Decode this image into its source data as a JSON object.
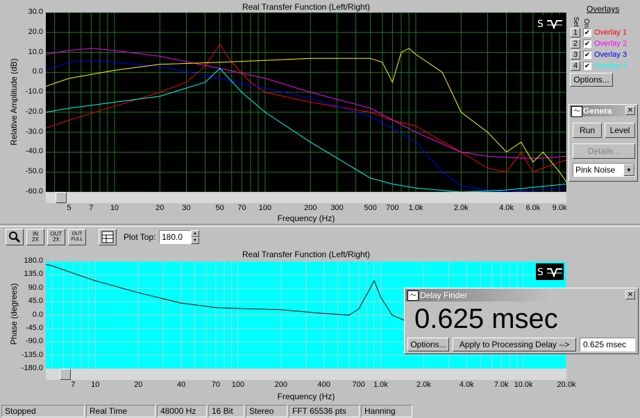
{
  "top_panel": {
    "title": "Real Transfer Function (Left/Right)",
    "ylabel": "Relative Amplitude (dB)",
    "xlabel": "Frequency (Hz)",
    "yticks": [
      "30.0",
      "20.0",
      "10.0",
      "0.0",
      "-10.0",
      "-20.0",
      "-30.0",
      "-40.0",
      "-50.0",
      "-60.0"
    ],
    "xticks": [
      "5",
      "7",
      "10",
      "20",
      "30",
      "50",
      "70",
      "100",
      "200",
      "300",
      "500",
      "700",
      "1.0k",
      "2.0k",
      "4.0k",
      "6.0k",
      "9.0k"
    ]
  },
  "bottom_panel": {
    "title": "Real Transfer Function (Left/Right)",
    "ylabel": "Phase (degrees)",
    "xlabel": "Frequency (Hz)",
    "yticks": [
      "180.0",
      "135.0",
      "90.0",
      "45.0",
      "0.0",
      "-45.0",
      "-90.0",
      "-135.0",
      "-180.0"
    ],
    "xticks": [
      "7",
      "10",
      "20",
      "40",
      "70",
      "100",
      "200",
      "400",
      "700",
      "1.0k",
      "2.0k",
      "4.0k",
      "7.0k",
      "10.0k",
      "20.0k"
    ]
  },
  "toolbar": {
    "plot_top_label": "Plot Top:",
    "plot_top_value": "180.0",
    "zoom_in_label": "IN\n2X",
    "zoom_out_label": "OUT\n2X",
    "zoom_full_label": "OUT\nFULL"
  },
  "overlays": {
    "title": "Overlays",
    "col_set": "Set",
    "col_on": "On",
    "items": [
      {
        "num": "1",
        "label": "Overlay 1",
        "color": "#ff0000"
      },
      {
        "num": "2",
        "label": "Overlay 2",
        "color": "#ff00ff"
      },
      {
        "num": "3",
        "label": "Overlay 3",
        "color": "#0000ff"
      },
      {
        "num": "4",
        "label": "Overlay 4",
        "color": "#00ffff"
      }
    ],
    "options_label": "Options..."
  },
  "generator": {
    "title": "Genera",
    "run_label": "Run",
    "level_label": "Level",
    "details_label": "Details...",
    "noise_value": "Pink Noise"
  },
  "delay_finder": {
    "title": "Delay Finder",
    "value": "0.625 msec",
    "options_label": "Options...",
    "apply_label": "Apply to Processing Delay -->",
    "field_value": "0.625 msec"
  },
  "status": [
    "Stopped",
    "Real Time",
    "48000 Hz",
    "16 Bit",
    "Stereo",
    "FFT 65536 pts",
    "Hanning"
  ],
  "chart_data": [
    {
      "type": "line",
      "title": "Real Transfer Function (Left/Right)",
      "xlabel": "Frequency (Hz)",
      "ylabel": "Relative Amplitude (dB)",
      "xscale": "log",
      "xlim": [
        3.5,
        10000
      ],
      "ylim": [
        -60,
        30
      ],
      "grid": true,
      "series": [
        {
          "name": "Overlay 1",
          "color": "#ff0000",
          "x": [
            3.5,
            5,
            10,
            20,
            30,
            40,
            50,
            60,
            80,
            100,
            200,
            500,
            700,
            1000,
            2000,
            3000,
            4000,
            5000,
            6000,
            7000,
            9000,
            10000
          ],
          "y": [
            -28,
            -24,
            -17,
            -10,
            -5,
            3,
            14,
            5,
            -5,
            -10,
            -15,
            -20,
            -24,
            -27,
            -40,
            -48,
            -50,
            -40,
            -50,
            -48,
            -45,
            -44
          ]
        },
        {
          "name": "Overlay 2",
          "color": "#ff00ff",
          "x": [
            3.5,
            5,
            7,
            10,
            20,
            50,
            100,
            200,
            500,
            1000,
            2000,
            3000,
            5000,
            7000,
            10000
          ],
          "y": [
            9,
            11,
            12,
            11,
            8,
            2,
            -3,
            -10,
            -18,
            -30,
            -40,
            -42,
            -43,
            -43,
            -42
          ]
        },
        {
          "name": "Overlay 3",
          "color": "#0000ff",
          "x": [
            3.5,
            5,
            7,
            10,
            20,
            50,
            100,
            200,
            500,
            700,
            1000,
            1500,
            2000,
            4000,
            10000
          ],
          "y": [
            1,
            5,
            6,
            5,
            3,
            -3,
            -8,
            -13,
            -22,
            -28,
            -35,
            -50,
            -57,
            -60,
            -58
          ]
        },
        {
          "name": "Overlay 4",
          "color": "#00ffff",
          "x": [
            3.5,
            5,
            10,
            20,
            40,
            50,
            70,
            100,
            200,
            500,
            700,
            1000,
            2000,
            4000,
            10000
          ],
          "y": [
            -20,
            -18,
            -15,
            -12,
            -5,
            2,
            -10,
            -20,
            -35,
            -53,
            -56,
            -58,
            -60,
            -59,
            -56
          ]
        },
        {
          "name": "",
          "color": "#ffff00",
          "x": [
            3.5,
            5,
            10,
            20,
            50,
            100,
            200,
            500,
            600,
            700,
            800,
            900,
            1000,
            1500,
            2000,
            3000,
            4000,
            5000,
            6000,
            7000,
            9000,
            10000
          ],
          "y": [
            -7,
            -3,
            1,
            4,
            5,
            6,
            7,
            7,
            5,
            -5,
            10,
            12,
            9,
            0,
            -20,
            -30,
            -40,
            -35,
            -45,
            -40,
            -50,
            -55
          ]
        }
      ]
    },
    {
      "type": "line",
      "title": "Real Transfer Function (Left/Right)",
      "xlabel": "Frequency (Hz)",
      "ylabel": "Phase (degrees)",
      "xscale": "log",
      "xlim": [
        4.5,
        20000
      ],
      "ylim": [
        -180,
        180
      ],
      "grid": true,
      "series": [
        {
          "name": "",
          "color": "#000000",
          "x": [
            4.5,
            5,
            7,
            10,
            20,
            40,
            70,
            100,
            200,
            400,
            600,
            700,
            800,
            900,
            1000,
            1200,
            1500,
            1800
          ],
          "y": [
            170,
            165,
            140,
            115,
            75,
            40,
            25,
            22,
            18,
            5,
            0,
            20,
            70,
            115,
            60,
            0,
            -20,
            30
          ]
        }
      ]
    }
  ]
}
